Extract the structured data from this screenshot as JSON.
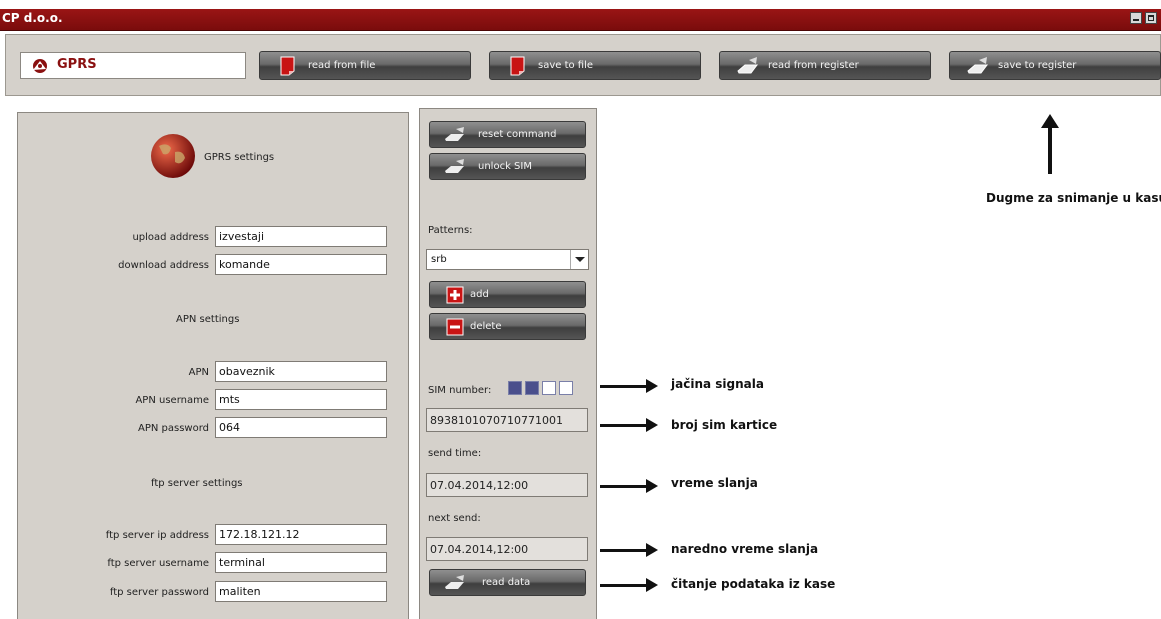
{
  "window": {
    "title": "CP d.o.o."
  },
  "toolbar": {
    "section": "GPRS",
    "buttons": [
      "read from file",
      "save to file",
      "read from register",
      "save to register"
    ]
  },
  "gprs": {
    "heading": "GPRS settings",
    "upload_label": "upload address",
    "upload_value": "izvestaji",
    "download_label": "download address",
    "download_value": "komande",
    "apn_heading": "APN settings",
    "apn_label": "APN",
    "apn_value": "obaveznik",
    "apn_user_label": "APN username",
    "apn_user_value": "mts",
    "apn_pass_label": "APN password",
    "apn_pass_value": "064",
    "ftp_heading": "ftp server settings",
    "ftp_ip_label": "ftp server ip address",
    "ftp_ip_value": "172.18.121.12",
    "ftp_user_label": "ftp server username",
    "ftp_user_value": "terminal",
    "ftp_pass_label": "ftp server password",
    "ftp_pass_value": "maliten"
  },
  "commands": {
    "reset": "reset command",
    "unlock": "unlock SIM",
    "patterns_label": "Patterns:",
    "pattern_selected": "srb",
    "add": "add",
    "delete": "delete",
    "sim_label": "SIM number:",
    "signal_level": 2,
    "signal_max": 4,
    "sim_number": "8938101070710771001",
    "send_time_label": "send time:",
    "send_time": "07.04.2014,12:00",
    "next_send_label": "next send:",
    "next_send": "07.04.2014,12:00",
    "read_data": "read data"
  },
  "annotations": {
    "save_register": "Dugme za snimanje u kasu",
    "signal": "jačina signala",
    "sim": "broj sim kartice",
    "send_time": "vreme slanja",
    "next_send": "naredno vreme slanja",
    "read_data": "čitanje podataka iz kase"
  },
  "colors": {
    "titlebar": "#8a1010",
    "panel": "#d5d1cb",
    "signal_on": "#4a4f8c"
  }
}
